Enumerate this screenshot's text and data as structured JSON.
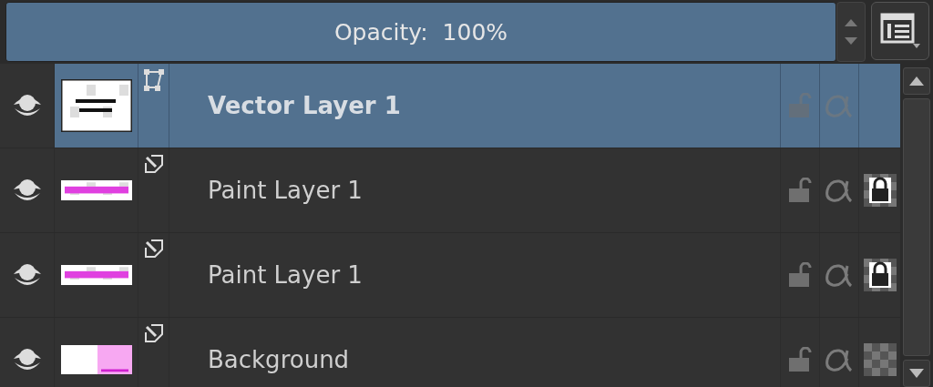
{
  "opacity": {
    "label": "Opacity:  100%",
    "level": 1.0
  },
  "layers": [
    {
      "name": "Vector Layer 1",
      "kind": "vector",
      "selected": true,
      "visible": true,
      "locked": false,
      "alpha_locked": false
    },
    {
      "name": "Paint Layer 1",
      "kind": "paint",
      "selected": false,
      "visible": true,
      "locked": false,
      "alpha_locked": false,
      "inherit_alpha_locked": true
    },
    {
      "name": "Paint Layer 1",
      "kind": "paint",
      "selected": false,
      "visible": true,
      "locked": false,
      "alpha_locked": false,
      "inherit_alpha_locked": true
    },
    {
      "name": "Background",
      "kind": "paint",
      "selected": false,
      "visible": true,
      "locked": false,
      "alpha_locked": false,
      "inherit_alpha_locked": false
    }
  ]
}
